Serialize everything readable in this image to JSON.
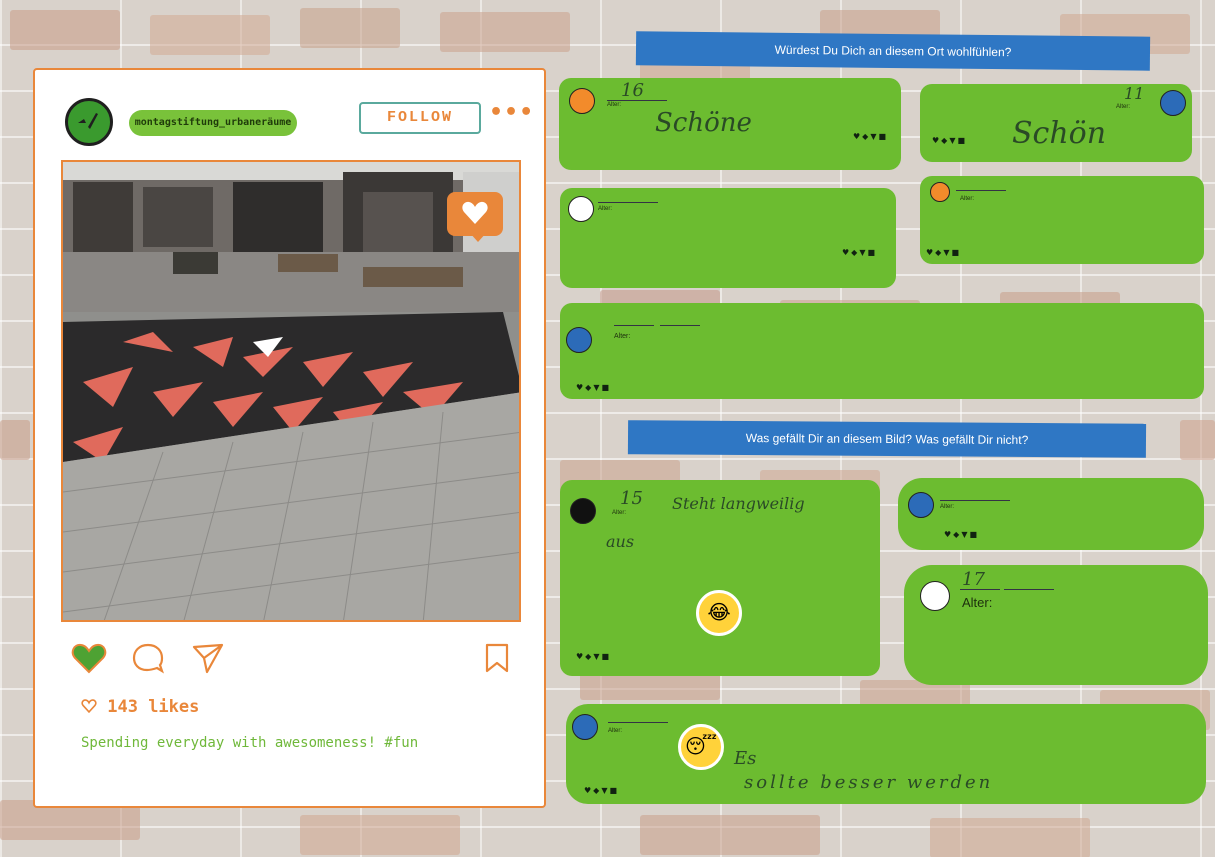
{
  "post": {
    "username": "montagstiftung_urbaneräume",
    "follow_label": "FOLLOW",
    "more_label": "•••",
    "likes_text": "143 likes",
    "caption": "Spending everyday with awesomeness! #fun",
    "accent_color": "#e9873a",
    "green_color": "#6fb83a"
  },
  "questions": {
    "q1": "Würdest Du Dich an diesem Ort wohlfühlen?",
    "q2": "Was gefällt Dir an diesem Bild? Was gefällt Dir nicht?"
  },
  "comments": {
    "c1": {
      "age": "16",
      "alter_label": "Alter:",
      "text": "Schöne",
      "icons": "♥◆▼■"
    },
    "c2": {
      "age": "11",
      "alter_label": "Alter:",
      "text": "Schön",
      "icons": "♥◆▼■"
    },
    "c3": {
      "alter_label": "Alter:",
      "icons": "♥◆▼■"
    },
    "c4": {
      "alter_label": "Alter:",
      "icons": "♥◆▼■"
    },
    "c5": {
      "alter_label": "Alter:",
      "icons": "♥◆▼■"
    },
    "c6": {
      "age": "15",
      "alter_label": "Alter:",
      "text": "Steht langweilig",
      "text2": "aus",
      "icons": "♥◆▼■"
    },
    "c7": {
      "alter_label": "Alter:",
      "icons": "♥◆▼■"
    },
    "c8": {
      "age": "17",
      "alter_label": "Alter:"
    },
    "c9": {
      "alter_label": "Alter:",
      "text": "Es",
      "text2": "sollte besser werden",
      "icons": "♥◆▼■"
    }
  }
}
